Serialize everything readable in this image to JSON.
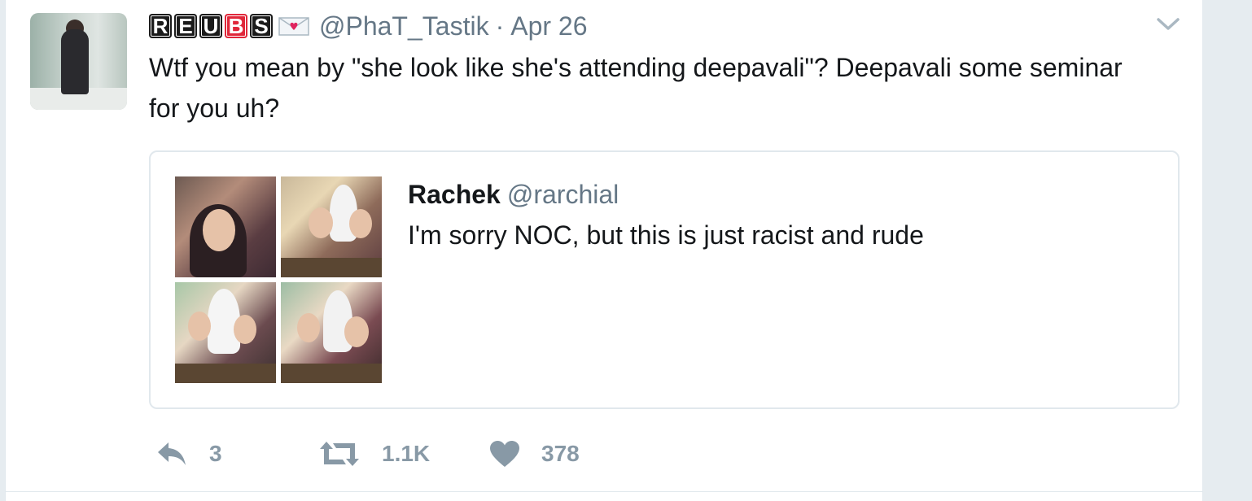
{
  "tweet": {
    "badges": [
      "R",
      "E",
      "U",
      "B",
      "S"
    ],
    "emoji_name": "love-letter-icon",
    "handle": "@PhaT_Tastik",
    "separator": "·",
    "date": "Apr 26",
    "text": "Wtf you mean by \"she look like she's attending deepavali\"? Deepavali some seminar for you uh?"
  },
  "quoted": {
    "name": "Rachek",
    "handle": "@rarchial",
    "text": "I'm sorry NOC, but this is just racist and rude"
  },
  "actions": {
    "reply_count": "3",
    "retweet_count": "1.1K",
    "like_count": "378"
  },
  "colors": {
    "text": "#14171a",
    "muted": "#657786",
    "icon": "#8899a6",
    "border": "#e1e8ed",
    "badge_dark": "#1b1b1b",
    "badge_red": "#e0273a"
  }
}
